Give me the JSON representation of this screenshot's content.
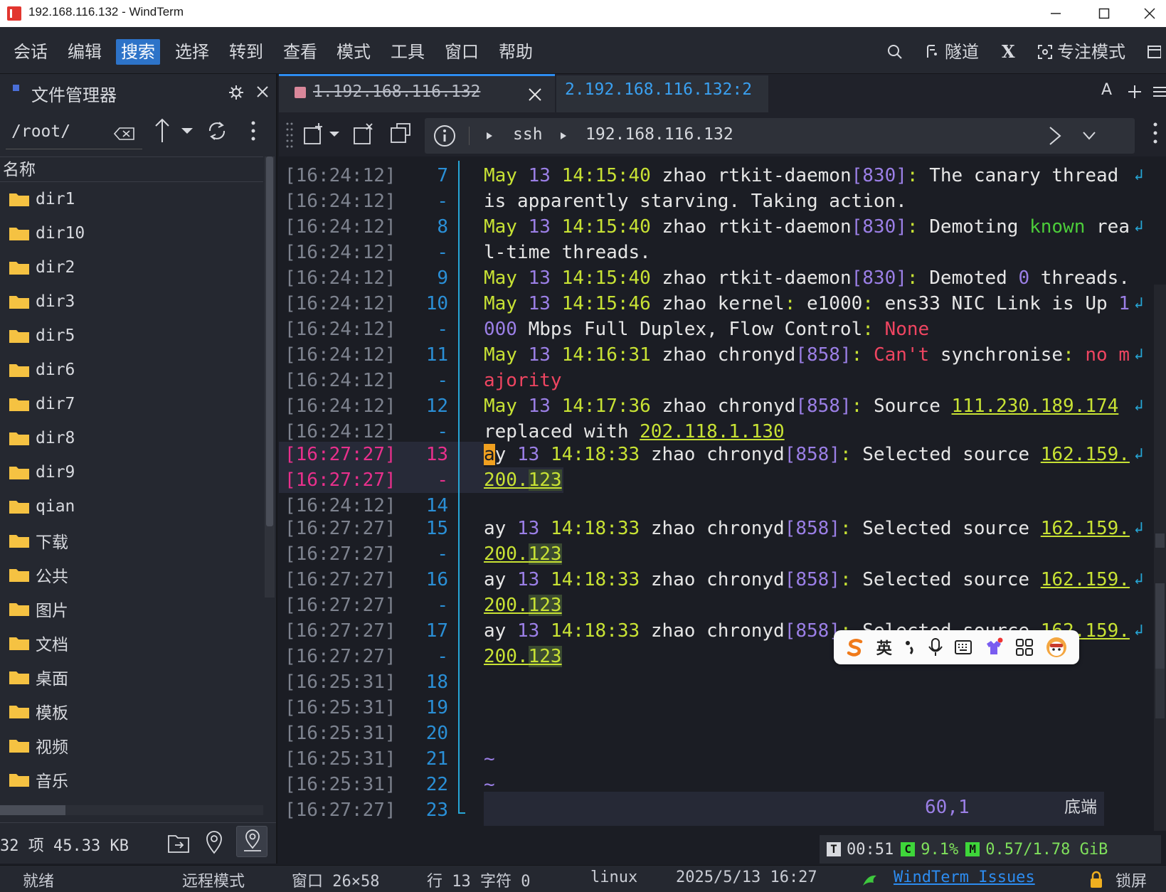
{
  "window": {
    "title": "192.168.116.132 - WindTerm"
  },
  "menu": {
    "items": [
      "会话",
      "编辑",
      "搜索",
      "选择",
      "转到",
      "查看",
      "模式",
      "工具",
      "窗口",
      "帮助"
    ],
    "active_index": 2,
    "tunnel_label": "隧道",
    "x_label": "X",
    "focus_label": "专注模式"
  },
  "file_manager": {
    "title": "文件管理器",
    "path": "/root/",
    "column_name": "名称",
    "items": [
      "dir1",
      "dir10",
      "dir2",
      "dir3",
      "dir5",
      "dir6",
      "dir7",
      "dir8",
      "dir9",
      "qian",
      "下载",
      "公共",
      "图片",
      "文档",
      "桌面",
      "模板",
      "视频",
      "音乐"
    ],
    "summary": "32 项 45.33 KB"
  },
  "tabs": [
    {
      "label": "1.192.168.116.132",
      "closed": true
    },
    {
      "label": "2.192.168.116.132:2"
    }
  ],
  "toolbar": {
    "protocol": "ssh",
    "host": "192.168.116.132",
    "font_label": "A"
  },
  "terminal": {
    "timestamps": [
      "[16:24:12]",
      "[16:24:12]",
      "[16:24:12]",
      "[16:24:12]",
      "[16:24:12]",
      "[16:24:12]",
      "[16:24:12]",
      "[16:24:12]",
      "[16:24:12]",
      "[16:24:12]",
      "[16:24:12]",
      "[16:27:27]",
      "[16:27:27]",
      "[16:24:12]",
      "[16:27:27]",
      "[16:27:27]",
      "[16:27:27]",
      "[16:27:27]",
      "[16:27:27]",
      "[16:27:27]",
      "[16:25:31]",
      "[16:25:31]",
      "[16:25:31]",
      "[16:25:31]",
      "[16:25:31]",
      "[16:27:27]"
    ],
    "line_numbers": [
      "7",
      "-",
      "8",
      "-",
      "9",
      "10",
      "-",
      "11",
      "-",
      "12",
      "-",
      "13",
      "-",
      "14",
      "15",
      "-",
      "16",
      "-",
      "17",
      "-",
      "18",
      "19",
      "20",
      "21",
      "22",
      "23"
    ],
    "cursor_pos": "60,1",
    "scroll_pos": "底端",
    "tilde": "~"
  },
  "log": {
    "month": "May",
    "day": "13",
    "host": "zhao",
    "l1_time": "14:15:40",
    "l1_proc": "rtkit-daemon",
    "l1_pid": "830",
    "l1_msg": "The canary thread",
    "l1b": "is apparently starving. Taking action.",
    "l2_msg_a": "Demoting",
    "l2_known": "known",
    "l2_msg_b": "rea",
    "l2b": "l-time threads.",
    "l3_msg_a": "Demoted",
    "l3_zero": "0",
    "l3_msg_b": "threads.",
    "l4_time": "14:15:46",
    "l4_proc": "kernel",
    "l4_dev": "e1000",
    "l4_msg": "ens33 NIC Link is Up",
    "l4_one": "1",
    "l4b_num": "000",
    "l4b_msg": "Mbps Full Duplex, Flow Control",
    "l4b_none": "None",
    "l5_time": "14:16:31",
    "l5_proc": "chronyd",
    "l5_pid": "858",
    "l5_cant": "Can't",
    "l5_sync": "synchronise",
    "l5_nom": "no m",
    "l5b": "ajority",
    "l6_time": "14:17:36",
    "l6_msg": "Source",
    "l6_ip": "111.230.189.174",
    "l6b_msg": "replaced with",
    "l6b_ip": "202.118.1.130",
    "sel_cursor": "a",
    "sel_prefix": "ay",
    "sel_time": "14:18:33",
    "sel_msg": "Selected source",
    "sel_ip_a": "162.159.",
    "sel_ip_b": "200.",
    "sel_ip_c": "123"
  },
  "ime": {
    "lang": "英"
  },
  "stats": {
    "time_badge": "T",
    "time": "00:51",
    "cpu_badge": "C",
    "cpu": "9.1%",
    "mem_badge": "M",
    "mem": "0.57/1.78 GiB"
  },
  "statusbar": {
    "ready": "就绪",
    "mode": "远程模式",
    "window": "窗口 26×58",
    "position": "行 13 字符 0",
    "os": "linux",
    "datetime": "2025/5/13 16:27",
    "issues": "WindTerm Issues",
    "lock": "锁屏"
  },
  "colors": {
    "accent": "#2d73c8",
    "tab_indicator": "#2d8cf0",
    "gutter": "#26a6d6",
    "folder": "#f5c242",
    "log_yellow": "#c8e234",
    "log_purple": "#9b7fe6",
    "log_red": "#ef4561",
    "log_green": "#4ccc3a",
    "highlight_timestamp": "#e8308c"
  }
}
